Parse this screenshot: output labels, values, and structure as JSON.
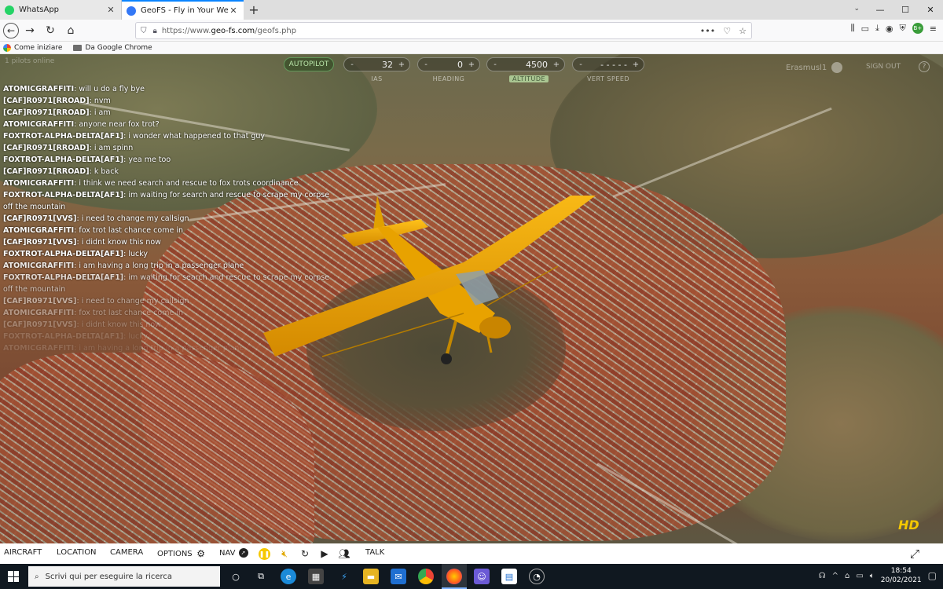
{
  "browser": {
    "tabs": [
      {
        "label": "WhatsApp",
        "active": false,
        "icon": "whatsapp-icon",
        "color": "#25d366"
      },
      {
        "label": "GeoFS - Fly in Your Web Browse",
        "active": true,
        "icon": "geofs-icon",
        "color": "#3478f6"
      }
    ],
    "url_prefix": "https://www.",
    "url_domain": "geo-fs.com",
    "url_path": "/geofs.php",
    "bookmarks": [
      "Come iniziare",
      "Da Google Chrome"
    ],
    "extension_badge": "B+"
  },
  "hud": {
    "pilots_online": "1 pilots online",
    "autopilot_label": "AUTOPILOT",
    "controls": [
      {
        "label": "IAS",
        "value": "32",
        "selected": false
      },
      {
        "label": "HEADING",
        "value": "0",
        "selected": false
      },
      {
        "label": "ALTITUDE",
        "value": "4500",
        "selected": true
      },
      {
        "label": "VERT SPEED",
        "value": "- - - - -",
        "selected": false
      }
    ],
    "minus": "-",
    "plus": "+",
    "username": "Erasmusl1",
    "sign_out": "SIGN OUT",
    "help": "?"
  },
  "chat": [
    {
      "user": "ATOMICGRAFFITI",
      "msg": "will u do a fly bye"
    },
    {
      "user": "[CAF]R0971[RROAD]",
      "msg": "nvm"
    },
    {
      "user": "[CAF]R0971[RROAD]",
      "msg": "i am"
    },
    {
      "user": "ATOMICGRAFFITI",
      "msg": "anyone near fox trot?"
    },
    {
      "user": "FOXTROT-ALPHA-DELTA[AF1]",
      "msg": "i wonder what happened to that guy"
    },
    {
      "user": "[CAF]R0971[RROAD]",
      "msg": "i am spinn"
    },
    {
      "user": "FOXTROT-ALPHA-DELTA[AF1]",
      "msg": "yea me too"
    },
    {
      "user": "[CAF]R0971[RROAD]",
      "msg": "k back"
    },
    {
      "user": "ATOMICGRAFFITI",
      "msg": "i think we need search and rescue to fox trots coordinance"
    },
    {
      "user": "FOXTROT-ALPHA-DELTA[AF1]",
      "msg": "im waiting for search and rescue to scrape my corpse"
    },
    {
      "user": "",
      "msg": "off the mountain"
    },
    {
      "user": "[CAF]R0971[VVS]",
      "msg": "i need to change my callsign"
    },
    {
      "user": "ATOMICGRAFFITI",
      "msg": "fox trot last chance come in"
    },
    {
      "user": "[CAF]R0971[VVS]",
      "msg": "i didnt know this now"
    },
    {
      "user": "FOXTROT-ALPHA-DELTA[AF1]",
      "msg": "lucky"
    },
    {
      "user": "ATOMICGRAFFITI",
      "msg": "i am having a long trip in a passenger plane"
    },
    {
      "user": "FOXTROT-ALPHA-DELTA[AF1]",
      "msg": "im waiting for search and rescue to scrape my corpse"
    },
    {
      "user": "",
      "msg": "off the mountain"
    },
    {
      "user": "[CAF]R0971[VVS]",
      "msg": "i need to change my callsign"
    },
    {
      "user": "ATOMICGRAFFITI",
      "msg": "fox trot last chance come in"
    },
    {
      "user": "[CAF]R0971[VVS]",
      "msg": "i didnt know this now"
    },
    {
      "user": "FOXTROT-ALPHA-DELTA[AF1]",
      "msg": "lucky"
    },
    {
      "user": "ATOMICGRAFFITI",
      "msg": "i am having a long trip in a passenger plane"
    }
  ],
  "hd_badge": "HD",
  "toolbar": {
    "aircraft": "AIRCRAFT",
    "location": "LOCATION",
    "camera": "CAMERA",
    "options": "OPTIONS",
    "nav": "NAV",
    "talk": "TALK"
  },
  "taskbar": {
    "search_placeholder": "Scrivi qui per eseguire la ricerca",
    "time": "18:54",
    "date": "20/02/2021"
  },
  "colors": {
    "accent_yellow": "#f5c800",
    "autopilot_green": "#b9e6a9",
    "active_tab": "#0a84ff"
  }
}
